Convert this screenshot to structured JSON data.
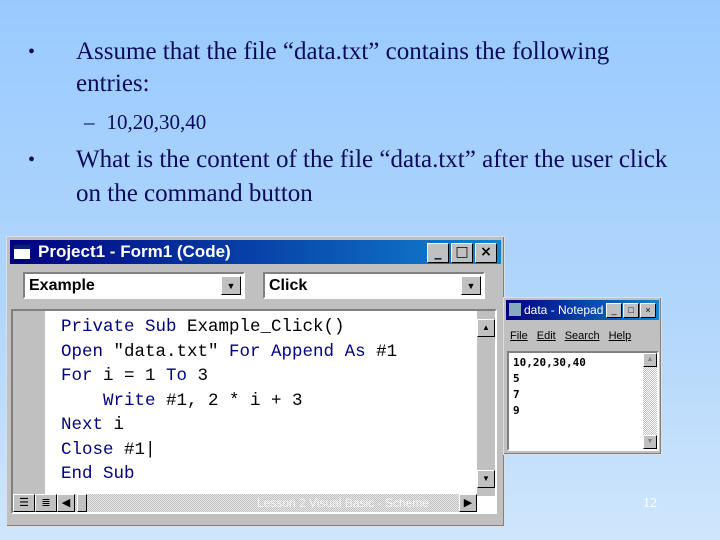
{
  "slide": {
    "bullet1": "Assume that the file “data.txt” contains the following entries:",
    "sub_bullet": "10,20,30,40",
    "bullet2": "What is the content of the file “data.txt” after the user click on the command button",
    "bullet_symbol": "•",
    "dash_symbol": "–",
    "page_number": "12",
    "footer": "Lesson 2 Visual Basic - Scheme"
  },
  "vb_window": {
    "title": "Project1 - Form1 (Code)",
    "buttons": {
      "minimize": "_",
      "maximize": "□",
      "close": "×"
    },
    "object_combo": "Example",
    "procedure_combo": "Click",
    "code_lines": [
      [
        {
          "t": "Private Sub ",
          "k": true
        },
        {
          "t": "Example_Click()",
          "k": false
        }
      ],
      [
        {
          "t": "Open ",
          "k": true
        },
        {
          "t": "\"data.txt\" ",
          "k": false
        },
        {
          "t": "For Append As ",
          "k": true
        },
        {
          "t": "#1",
          "k": false
        }
      ],
      [
        {
          "t": "For ",
          "k": true
        },
        {
          "t": "i = 1 ",
          "k": false
        },
        {
          "t": "To ",
          "k": true
        },
        {
          "t": "3",
          "k": false
        }
      ],
      [
        {
          "t": "    Write ",
          "k": true
        },
        {
          "t": "#1, 2 * i + 3",
          "k": false
        }
      ],
      [
        {
          "t": "Next ",
          "k": true
        },
        {
          "t": "i",
          "k": false
        }
      ],
      [
        {
          "t": "Close ",
          "k": true
        },
        {
          "t": "#1|",
          "k": false
        }
      ],
      [
        {
          "t": "End Sub",
          "k": true
        }
      ]
    ]
  },
  "notepad": {
    "title": "data - Notepad",
    "menu": [
      "File",
      "Edit",
      "Search",
      "Help"
    ],
    "lines": [
      "10,20,30,40",
      "5",
      "7",
      "9"
    ]
  }
}
